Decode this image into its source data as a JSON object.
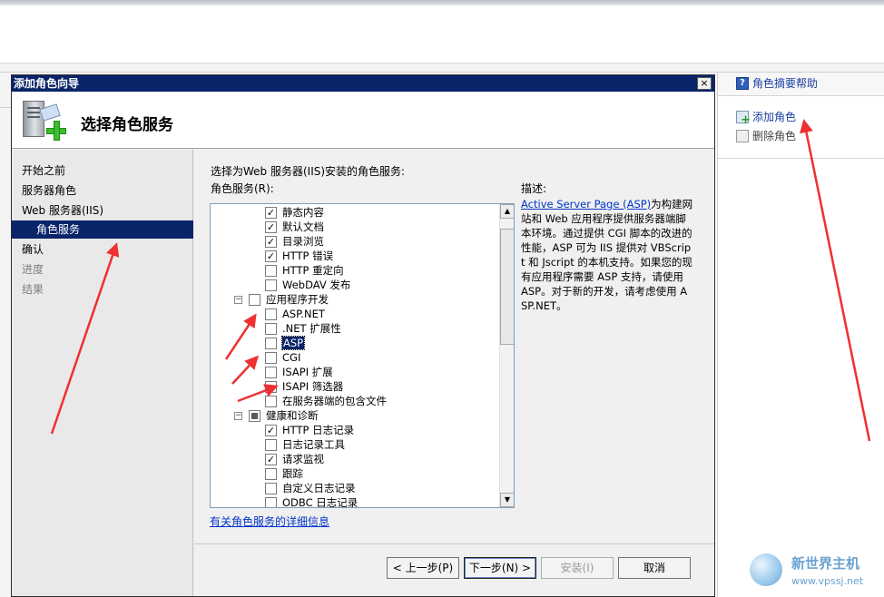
{
  "actions_pane": {
    "help": "角色摘要帮助",
    "add_role": "添加角色",
    "remove_role": "删除角色"
  },
  "dialog": {
    "title": "添加角色向导",
    "close": "×",
    "header_title": "选择角色服务",
    "nav": [
      {
        "label": "开始之前",
        "state": "normal"
      },
      {
        "label": "服务器角色",
        "state": "normal"
      },
      {
        "label": "Web 服务器(IIS)",
        "state": "normal"
      },
      {
        "label": "角色服务",
        "state": "selected"
      },
      {
        "label": "确认",
        "state": "normal"
      },
      {
        "label": "进度",
        "state": "disabled"
      },
      {
        "label": "结果",
        "state": "disabled"
      }
    ],
    "instruction": "选择为Web 服务器(IIS)安装的角色服务:",
    "services_label": "角色服务(R):",
    "description_label": "描述:",
    "tree": [
      {
        "label": "静态内容",
        "checked": true,
        "level": 2
      },
      {
        "label": "默认文档",
        "checked": true,
        "level": 2
      },
      {
        "label": "目录浏览",
        "checked": true,
        "level": 2
      },
      {
        "label": "HTTP 错误",
        "checked": true,
        "level": 2
      },
      {
        "label": "HTTP 重定向",
        "checked": false,
        "level": 2
      },
      {
        "label": "WebDAV 发布",
        "checked": false,
        "level": 2
      },
      {
        "label": "应用程序开发",
        "checked": false,
        "level": 1,
        "expander": "−"
      },
      {
        "label": "ASP.NET",
        "checked": false,
        "level": 2
      },
      {
        "label": ".NET 扩展性",
        "checked": false,
        "level": 2
      },
      {
        "label": "ASP",
        "checked": false,
        "level": 2,
        "highlight": true
      },
      {
        "label": "CGI",
        "checked": false,
        "level": 2
      },
      {
        "label": "ISAPI 扩展",
        "checked": false,
        "level": 2
      },
      {
        "label": "ISAPI 筛选器",
        "checked": false,
        "level": 2
      },
      {
        "label": "在服务器端的包含文件",
        "checked": false,
        "level": 2
      },
      {
        "label": "健康和诊断",
        "checked": "partial",
        "level": 1,
        "expander": "−"
      },
      {
        "label": "HTTP 日志记录",
        "checked": true,
        "level": 2
      },
      {
        "label": "日志记录工具",
        "checked": false,
        "level": 2
      },
      {
        "label": "请求监视",
        "checked": true,
        "level": 2
      },
      {
        "label": "跟踪",
        "checked": false,
        "level": 2
      },
      {
        "label": "自定义日志记录",
        "checked": false,
        "level": 2
      },
      {
        "label": "ODBC 日志记录",
        "checked": false,
        "level": 2
      }
    ],
    "description": {
      "link": "Active Server Page (ASP)",
      "text": "为构建网站和 Web 应用程序提供服务器端脚本环境。通过提供 CGI 脚本的改进的性能，ASP 可为 IIS 提供对 VBScript 和 Jscript 的本机支持。如果您的现有应用程序需要 ASP 支持，请使用 ASP。对于新的开发，请考虑使用 ASP.NET。"
    },
    "more_info_link": "有关角色服务的详细信息",
    "buttons": {
      "back": "< 上一步(P)",
      "next": "下一步(N) >",
      "install": "安装(I)",
      "cancel": "取消"
    }
  },
  "watermark": {
    "name": "新世界主机",
    "url": "www.vpssj.net"
  },
  "colors": {
    "titlebar": "#0a246a",
    "selection": "#0a246a",
    "link": "#0033cc",
    "annotation_arrow": "#ee3030"
  }
}
